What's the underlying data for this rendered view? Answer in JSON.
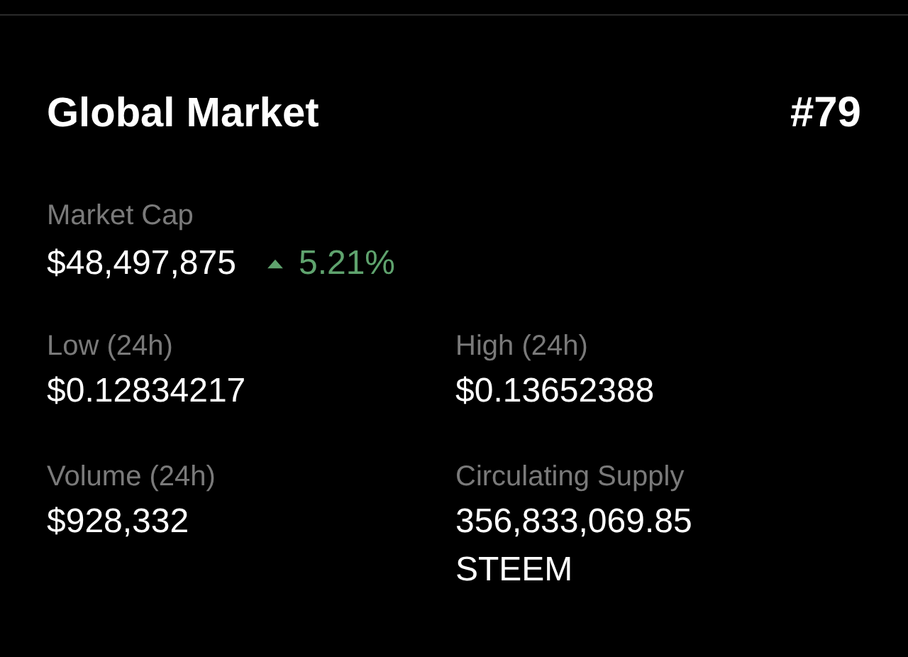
{
  "title": "Global Market",
  "rank": "#79",
  "market_cap": {
    "label": "Market Cap",
    "value": "$48,497,875",
    "change": {
      "rising": true,
      "text": "5.21%"
    }
  },
  "stats": [
    {
      "label": "Low (24h)",
      "value": "$0.12834217"
    },
    {
      "label": "High (24h)",
      "value": "$0.13652388"
    },
    {
      "label": "Volume (24h)",
      "value": "$928,332"
    },
    {
      "label": "Circulating Supply",
      "value": "356,833,069.85 STEEM"
    }
  ]
}
